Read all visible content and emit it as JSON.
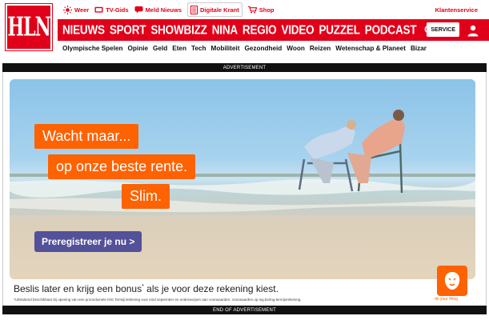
{
  "logo": {
    "text": "HLN"
  },
  "topbar": {
    "items": [
      {
        "label": "Weer",
        "icon": "sun-icon"
      },
      {
        "label": "TV-Gids",
        "icon": "tv-icon"
      },
      {
        "label": "Meld Nieuws",
        "icon": "chat-icon"
      },
      {
        "label": "Digitale Krant",
        "icon": "newspaper-icon"
      },
      {
        "label": "Shop",
        "icon": "cart-icon"
      }
    ],
    "klantenservice": "Klantenservice"
  },
  "nav": {
    "items": [
      "NIEUWS",
      "SPORT",
      "SHOWBIZZ",
      "NINA",
      "REGIO",
      "VIDEO",
      "PUZZEL",
      "PODCAST"
    ],
    "service_label": "SERVICE"
  },
  "subnav": {
    "items": [
      "Olympische Spelen",
      "Opinie",
      "Geld",
      "Eten",
      "Tech",
      "Mobiliteit",
      "Gezondheid",
      "Woon",
      "Reizen",
      "Wetenschap & Planeet",
      "Bizar"
    ]
  },
  "ad": {
    "label_top": "ADVERTISEMENT",
    "label_bottom": "END OF ADVERTISEMENT",
    "line1": "Wacht maar...",
    "line2": "op onze beste rente.",
    "line3": "Slim.",
    "cta": "Preregistreer je nu >",
    "headline_a": "Beslis later en krijg een bonus",
    "headline_sup": "*",
    "headline_b": " als je voor deze rekening kiest.",
    "disclaimer": "*Uitsluitend beschikbaar bij opening van een promotionele ING Termijnrekening voor eind september en onderworpen aan voorwaarden. Voorwaarden op ing.be/ing-termijnrekening.",
    "brand_tagline": "do your thing"
  },
  "colors": {
    "brand_red": "#e1001a",
    "ing_orange": "#ff6200",
    "cta_purple": "#525199"
  }
}
